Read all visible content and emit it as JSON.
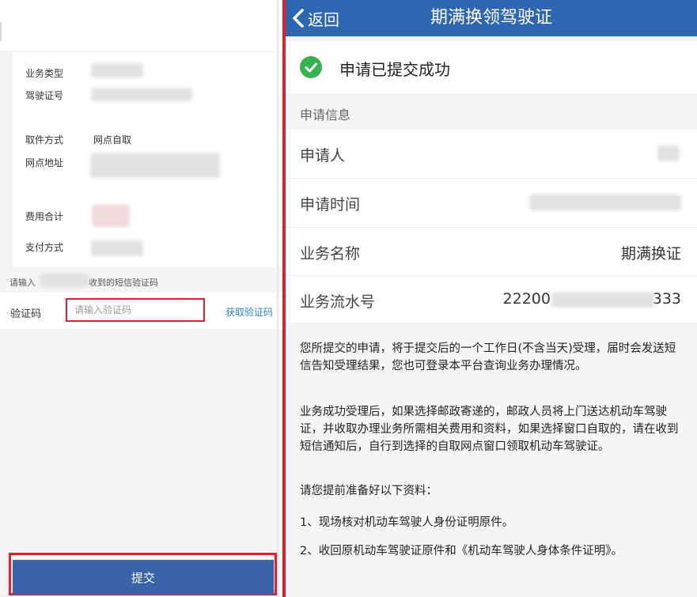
{
  "left_panel": {
    "fields": [
      {
        "label": "业务类型",
        "value": ""
      },
      {
        "label": "驾驶证号",
        "value": ""
      },
      {
        "label": "取件方式",
        "value": "网点自取"
      },
      {
        "label": "网点地址",
        "value": ""
      },
      {
        "label": "费用合计",
        "value": ""
      },
      {
        "label": "支付方式",
        "value": ""
      }
    ],
    "sms_hint_prefix": "请输入",
    "sms_hint_suffix": "收到的短信验证码",
    "code_label": "验证码",
    "code_placeholder": "请输入验证码",
    "code_value": "",
    "get_code_label": "获取验证码",
    "submit_label": "提交"
  },
  "right_panel": {
    "back_label": "返回",
    "title": "期满换领驾驶证",
    "success_text": "申请已提交成功",
    "section_title": "申请信息",
    "info": [
      {
        "label": "申请人",
        "value": ""
      },
      {
        "label": "申请时间",
        "value": ""
      },
      {
        "label": "业务名称",
        "value": "期满换证"
      },
      {
        "label": "业务流水号",
        "value_prefix": "22200",
        "value_suffix": "333"
      }
    ],
    "notices": [
      "您所提交的申请，将于提交后的一个工作日(不含当天)受理，届时会发送短信告知受理结果，您也可登录本平台查询业务办理情况。",
      "业务成功受理后，如果选择邮政寄递的，邮政人员将上门送达机动车驾驶证，并收取办理业务所需相关费用和资料，如果选择窗口自取的，请在收到短信通知后，自行到选择的自取网点窗口领取机动车驾驶证。",
      "请您提前准备好以下资料：",
      "1、现场核对机动车驾驶人身份证明原件。",
      "2、收回原机动车驾驶证原件和《机动车驾驶人身体条件证明》。"
    ]
  },
  "colors": {
    "nav_blue": "#2f66b0",
    "button_blue": "#3a62a8",
    "highlight_red": "#e0202a",
    "success_green": "#36b34f",
    "link_blue": "#2a7fd1"
  },
  "icons": [
    "back-chevron-icon",
    "check-circle-icon"
  ]
}
